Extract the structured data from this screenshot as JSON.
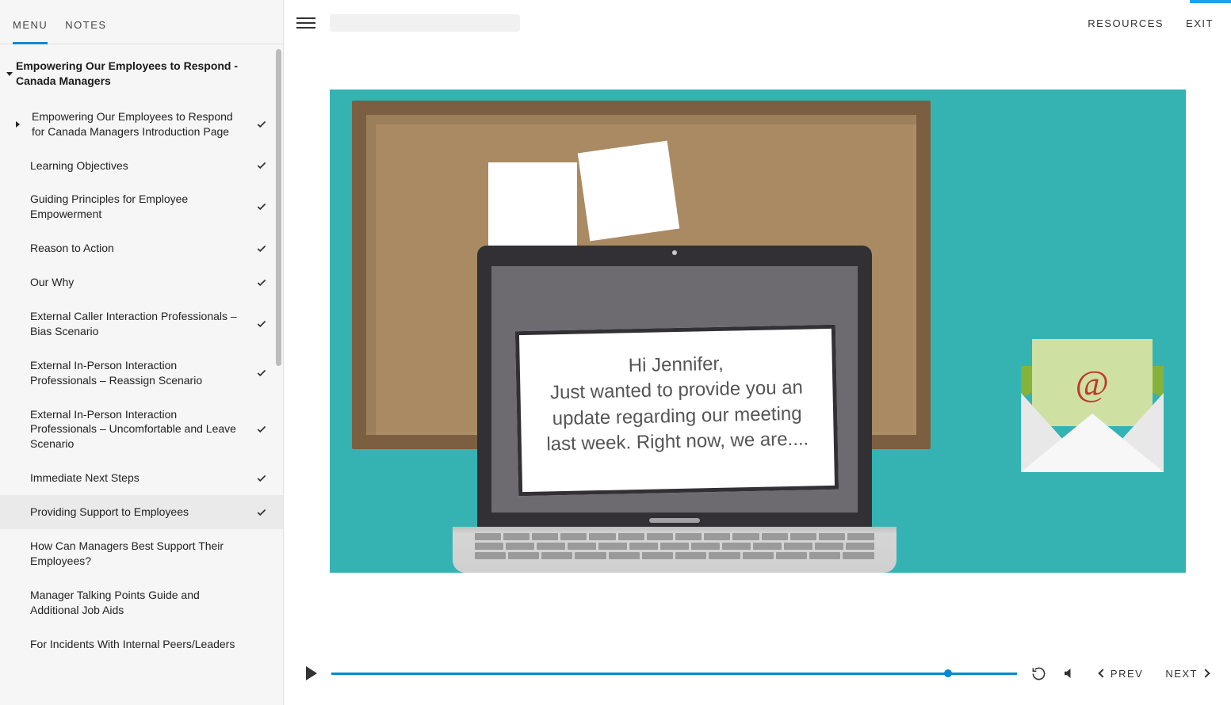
{
  "sidebar": {
    "tabs": {
      "menu": "MENU",
      "notes": "NOTES"
    },
    "course_title": "Empowering Our Employees to Respond - Canada Managers",
    "items": [
      {
        "label": "Empowering Our Employees to Respond for Canada Managers Introduction Page",
        "done": true,
        "expandable": true
      },
      {
        "label": "Learning Objectives",
        "done": true
      },
      {
        "label": "Guiding Principles for Employee Empowerment",
        "done": true
      },
      {
        "label": "Reason to Action",
        "done": true
      },
      {
        "label": "Our Why",
        "done": true
      },
      {
        "label": "External Caller Interaction Professionals – Bias Scenario",
        "done": true
      },
      {
        "label": "External In-Person Interaction Professionals – Reassign Scenario",
        "done": true
      },
      {
        "label": "External In-Person Interaction Professionals – Uncomfortable and Leave Scenario",
        "done": true
      },
      {
        "label": "Immediate Next Steps",
        "done": true
      },
      {
        "label": "Providing Support to Employees",
        "done": true,
        "selected": true
      },
      {
        "label": "How Can Managers Best Support Their Employees?",
        "done": false
      },
      {
        "label": "Manager Talking Points Guide and Additional Job Aids",
        "done": false
      },
      {
        "label": "For Incidents With Internal Peers/Leaders",
        "done": false
      }
    ]
  },
  "topbar": {
    "resources": "RESOURCES",
    "exit": "EXIT"
  },
  "slide": {
    "note_text": "Hi Jennifer,\nJust wanted to provide you an update regarding our meeting last week. Right now, we are....",
    "envelope_at": "@"
  },
  "player": {
    "progress_pct": 90,
    "prev": "PREV",
    "next": "NEXT"
  }
}
